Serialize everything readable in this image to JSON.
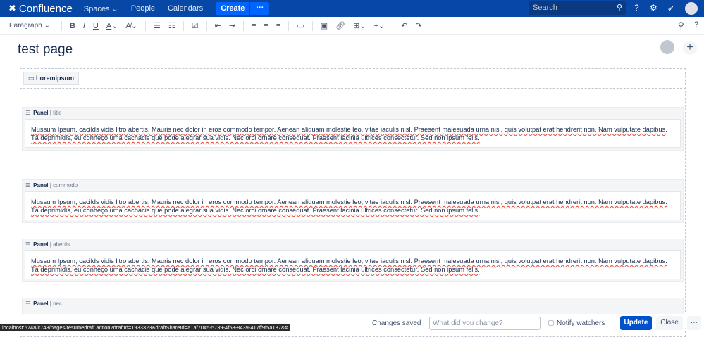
{
  "header": {
    "app": "Confluence",
    "nav": [
      "Spaces",
      "People",
      "Calendars"
    ],
    "create": "Create",
    "more": "···",
    "search_placeholder": "Search"
  },
  "toolbar": {
    "paragraph": "Paragraph"
  },
  "page": {
    "title": "test page"
  },
  "macro": {
    "label": "Loremipsum"
  },
  "panels": [
    {
      "type": "Panel",
      "title": "title",
      "text": "Mussum Ipsum, cacilds vidis litro abertis. Mauris nec dolor in eros commodo tempor. Aenean aliquam molestie leo, vitae iaculis nisl. Praesent malesuada urna nisi, quis volutpat erat hendrerit non. Nam vulputate dapibus. Tá deprimidis, eu conheço uma cachacis que pode alegrar sua vidis. Nec orci ornare consequat. Praesent lacinia ultrices consectetur. Sed non ipsum felis."
    },
    {
      "type": "Panel",
      "title": "commodo",
      "text": "Mussum Ipsum, cacilds vidis litro abertis. Mauris nec dolor in eros commodo tempor. Aenean aliquam molestie leo, vitae iaculis nisl. Praesent malesuada urna nisi, quis volutpat erat hendrerit non. Nam vulputate dapibus. Tá deprimidis, eu conheço uma cachacis que pode alegrar sua vidis. Nec orci ornare consequat. Praesent lacinia ultrices consectetur. Sed non ipsum felis."
    },
    {
      "type": "Panel",
      "title": "abertis",
      "text": "Mussum Ipsum, cacilds vidis litro abertis. Mauris nec dolor in eros commodo tempor. Aenean aliquam molestie leo, vitae iaculis nisl. Praesent malesuada urna nisi, quis volutpat erat hendrerit non. Nam vulputate dapibus. Tá deprimidis, eu conheço uma cachacis que pode alegrar sua vidis. Nec orci ornare consequat. Praesent lacinia ultrices consectetur. Sed non ipsum felis."
    },
    {
      "type": "Panel",
      "title": "nec",
      "text": ""
    }
  ],
  "footer": {
    "status": "Changes saved",
    "comment_placeholder": "What did you change?",
    "notify": "Notify watchers",
    "update": "Update",
    "close": "Close",
    "more": "···"
  },
  "statusbar": "localhost:6748/c748/pages/resumedraft.action?draftId=1933323&draftShareId=a1af7045-5739-4f53-8439-417ff9f5a187&#"
}
